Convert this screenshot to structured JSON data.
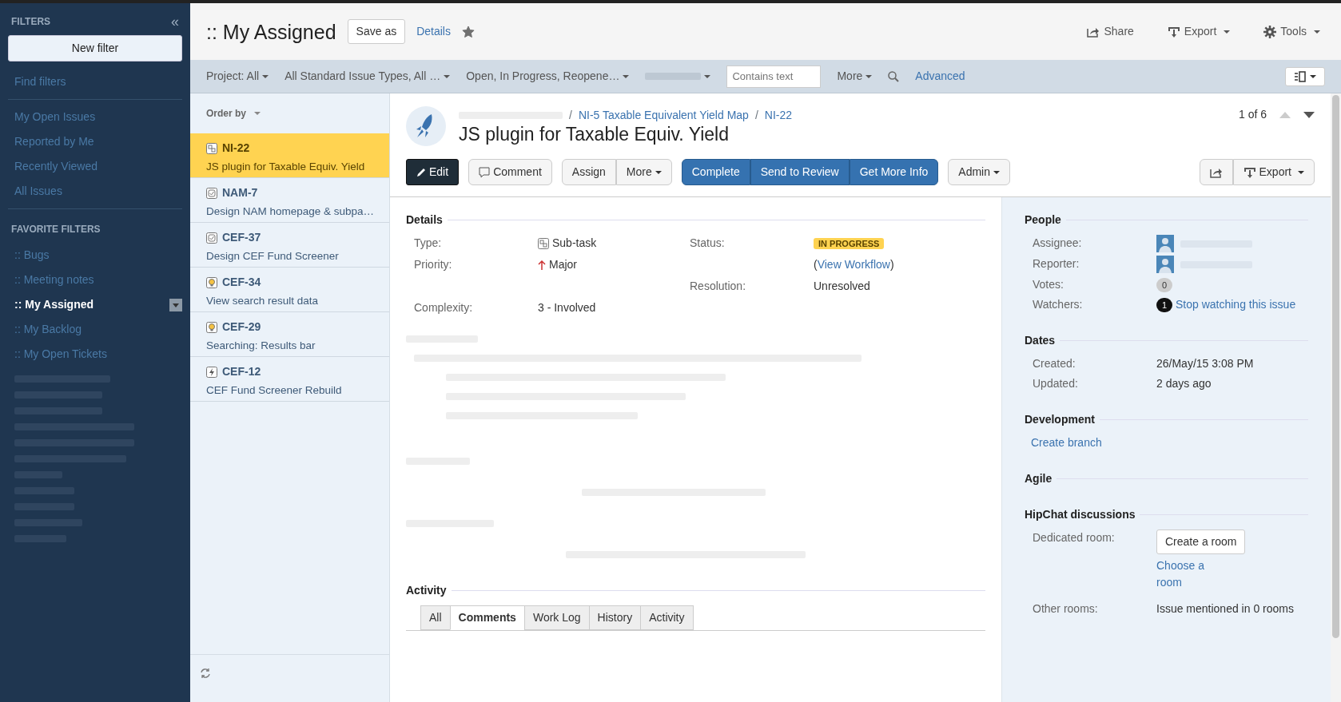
{
  "sidebar": {
    "title": "FILTERS",
    "collapse": "«",
    "new_filter": "New filter",
    "find_filters": "Find filters",
    "items": [
      {
        "label": "My Open Issues"
      },
      {
        "label": "Reported by Me"
      },
      {
        "label": "Recently Viewed"
      },
      {
        "label": "All Issues"
      }
    ],
    "favorites_title": "FAVORITE FILTERS",
    "favorites": [
      {
        "label": ":: Bugs",
        "selected": false
      },
      {
        "label": ":: Meeting notes",
        "selected": false
      },
      {
        "label": ":: My Assigned",
        "selected": true
      },
      {
        "label": ":: My Backlog",
        "selected": false
      },
      {
        "label": ":: My Open Tickets",
        "selected": false
      }
    ]
  },
  "header": {
    "title": ":: My Assigned",
    "save_as": "Save as",
    "details": "Details",
    "starred": true,
    "actions": [
      {
        "label": "Share",
        "kind": "share"
      },
      {
        "label": "Export",
        "kind": "export"
      },
      {
        "label": "Tools",
        "kind": "tools"
      }
    ]
  },
  "filter_bar": {
    "dropdowns": [
      "Project: All",
      "All Standard Issue Types, All …",
      "Open, In Progress, Reopene…"
    ],
    "search": {
      "placeholder": "Contains text"
    },
    "more": "More",
    "advanced": "Advanced"
  },
  "issue_list": {
    "order_by": "Order by",
    "items": [
      {
        "key": "NI-22",
        "summary": "JS plugin for Taxable Equiv. Yield",
        "kind": "subtask",
        "selected": true
      },
      {
        "key": "NAM-7",
        "summary": "Design NAM homepage & subpa…",
        "kind": "task",
        "selected": false
      },
      {
        "key": "CEF-37",
        "summary": "Design CEF Fund Screener",
        "kind": "task",
        "selected": false
      },
      {
        "key": "CEF-34",
        "summary": "View search result data",
        "kind": "idea",
        "selected": false
      },
      {
        "key": "CEF-29",
        "summary": "Searching: Results bar",
        "kind": "idea",
        "selected": false
      },
      {
        "key": "CEF-12",
        "summary": "CEF Fund Screener Rebuild",
        "kind": "epic",
        "selected": false
      }
    ]
  },
  "view_toggle": {
    "selected": true
  },
  "issue": {
    "breadcrumb": [
      {
        "separator": "/",
        "label": "NI-5 Taxable Equivalent Yield Map"
      },
      {
        "separator": "/",
        "label": "NI-22"
      }
    ],
    "title": "JS plugin for Taxable Equiv. Yield",
    "pager": "1 of 6",
    "buttons": {
      "edit": "Edit",
      "comment": "Comment",
      "assign": "Assign",
      "more": "More",
      "workflow": [
        "Complete",
        "Send to Review",
        "Get More Info"
      ],
      "admin": "Admin",
      "export": "Export"
    },
    "details": {
      "heading": "Details",
      "type_label": "Type:",
      "type": "Sub-task",
      "priority_label": "Priority:",
      "priority": "Major",
      "complexity_label": "Complexity:",
      "complexity": "3 - Involved",
      "status_label": "Status:",
      "status": "IN PROGRESS",
      "workflow": {
        "before": "(",
        "link": "View Workflow",
        "after": ")"
      },
      "resolution_label": "Resolution:",
      "resolution": "Unresolved"
    },
    "activity": {
      "heading": "Activity",
      "tabs": [
        {
          "label": "All",
          "selected": false
        },
        {
          "label": "Comments",
          "selected": true
        },
        {
          "label": "Work Log",
          "selected": false
        },
        {
          "label": "History",
          "selected": false
        },
        {
          "label": "Activity",
          "selected": false
        }
      ]
    },
    "people": {
      "heading": "People",
      "assignee_label": "Assignee:",
      "reporter_label": "Reporter:",
      "votes_label": "Votes:",
      "votes": "0",
      "watchers_label": "Watchers:",
      "watchers": "1",
      "watch_link": "Stop watching this issue"
    },
    "dates": {
      "heading": "Dates",
      "created_label": "Created:",
      "created": "26/May/15 3:08 PM",
      "updated_label": "Updated:",
      "updated": "2 days ago"
    },
    "development": {
      "heading": "Development",
      "link": "Create branch"
    },
    "agile": {
      "heading": "Agile"
    },
    "hipchat": {
      "heading": "HipChat discussions",
      "dedicated_label": "Dedicated room:",
      "create_button": "Create a room",
      "choose_link": "Choose a room",
      "other_label": "Other rooms:",
      "other": "Issue mentioned in 0 rooms"
    }
  }
}
